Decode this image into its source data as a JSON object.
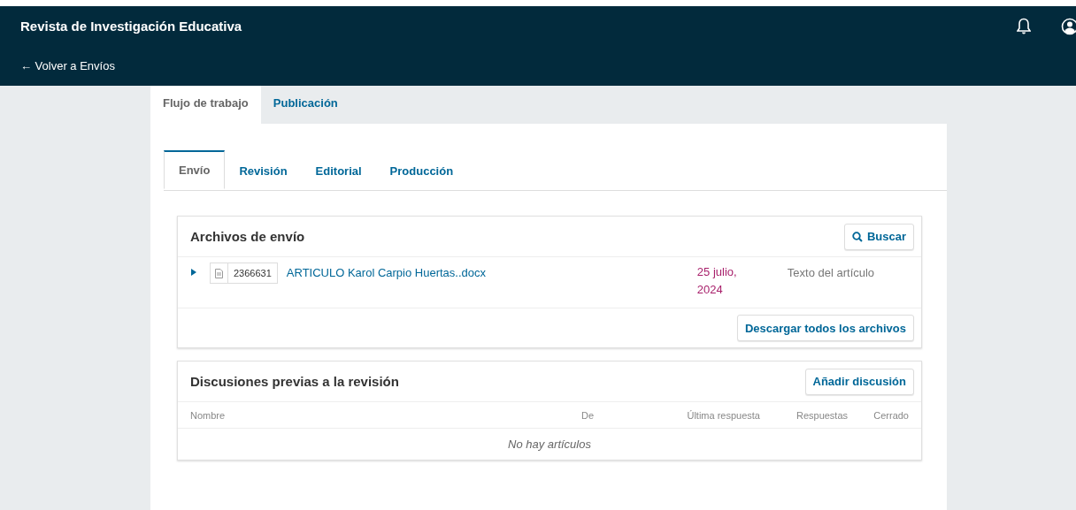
{
  "header": {
    "journal_title": "Revista de Investigación Educativa",
    "back_link": "← Volver a Envíos"
  },
  "main_tabs": [
    {
      "label": "Flujo de trabajo",
      "selected": true
    },
    {
      "label": "Publicación",
      "selected": false
    }
  ],
  "stage_tabs": [
    {
      "label": "Envío",
      "selected": true
    },
    {
      "label": "Revisión",
      "selected": false
    },
    {
      "label": "Editorial",
      "selected": false
    },
    {
      "label": "Producción",
      "selected": false
    }
  ],
  "files_panel": {
    "title": "Archivos de envío",
    "search_button": "Buscar",
    "files": [
      {
        "id": "2366631",
        "name": "ARTICULO Karol Carpio Huertas..docx",
        "date": "25 julio, 2024",
        "type": "Texto del artículo",
        "expanded": false
      }
    ],
    "download_button": "Descargar todos los archivos"
  },
  "discussions_panel": {
    "title": "Discusiones previas a la revisión",
    "add_button": "Añadir discusión",
    "columns": [
      "Nombre",
      "De",
      "Última respuesta",
      "Respuestas",
      "Cerrado"
    ],
    "empty_message": "No hay artículos"
  }
}
